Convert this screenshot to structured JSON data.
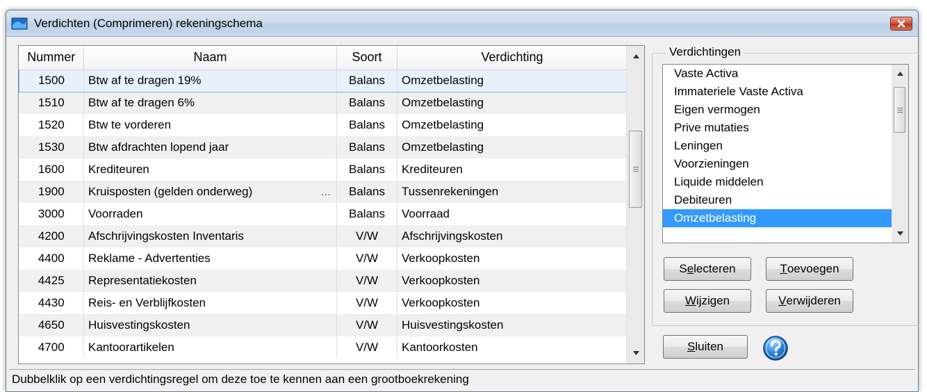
{
  "window": {
    "title": "Verdichten (Comprimeren) rekeningschema"
  },
  "table": {
    "headers": {
      "nummer": "Nummer",
      "naam": "Naam",
      "soort": "Soort",
      "verdichting": "Verdichting"
    },
    "rows": [
      {
        "nummer": "1500",
        "naam": "Btw af te dragen 19%",
        "soort": "Balans",
        "verdichting": "Omzetbelasting",
        "ellipsis": ""
      },
      {
        "nummer": "1510",
        "naam": "Btw af te dragen 6%",
        "soort": "Balans",
        "verdichting": "Omzetbelasting",
        "ellipsis": ""
      },
      {
        "nummer": "1520",
        "naam": "Btw te vorderen",
        "soort": "Balans",
        "verdichting": "Omzetbelasting",
        "ellipsis": ""
      },
      {
        "nummer": "1530",
        "naam": "Btw afdrachten lopend jaar",
        "soort": "Balans",
        "verdichting": "Omzetbelasting",
        "ellipsis": ""
      },
      {
        "nummer": "1600",
        "naam": "Krediteuren",
        "soort": "Balans",
        "verdichting": "Krediteuren",
        "ellipsis": ""
      },
      {
        "nummer": "1900",
        "naam": "Kruisposten (gelden onderweg)",
        "soort": "Balans",
        "verdichting": "Tussenrekeningen",
        "ellipsis": "..."
      },
      {
        "nummer": "3000",
        "naam": "Voorraden",
        "soort": "Balans",
        "verdichting": "Voorraad",
        "ellipsis": ""
      },
      {
        "nummer": "4200",
        "naam": "Afschrijvingskosten Inventaris",
        "soort": "V/W",
        "verdichting": "Afschrijvingskosten",
        "ellipsis": ""
      },
      {
        "nummer": "4400",
        "naam": "Reklame - Advertenties",
        "soort": "V/W",
        "verdichting": "Verkoopkosten",
        "ellipsis": ""
      },
      {
        "nummer": "4425",
        "naam": "Representatiekosten",
        "soort": "V/W",
        "verdichting": "Verkoopkosten",
        "ellipsis": ""
      },
      {
        "nummer": "4430",
        "naam": "Reis- en Verblijfkosten",
        "soort": "V/W",
        "verdichting": "Verkoopkosten",
        "ellipsis": ""
      },
      {
        "nummer": "4650",
        "naam": "Huisvestingskosten",
        "soort": "V/W",
        "verdichting": "Huisvestingskosten",
        "ellipsis": ""
      },
      {
        "nummer": "4700",
        "naam": "Kantoorartikelen",
        "soort": "V/W",
        "verdichting": "Kantoorkosten",
        "ellipsis": ""
      }
    ]
  },
  "verdichtingen": {
    "legend": "Verdichtingen",
    "items": [
      "Vaste Activa",
      "Immateriele Vaste Activa",
      "Eigen vermogen",
      "Prive mutaties",
      "Leningen",
      "Voorzieningen",
      "Liquide middelen",
      "Debiteuren",
      "Omzetbelasting"
    ],
    "selected": "Omzetbelasting"
  },
  "buttons": {
    "selecteren": {
      "pre": "S",
      "u": "e",
      "post": "lecteren"
    },
    "toevoegen": {
      "pre": "",
      "u": "T",
      "post": "oevoegen"
    },
    "wijzigen": {
      "pre": "",
      "u": "W",
      "post": "ijzigen"
    },
    "verwijderen": {
      "pre": "",
      "u": "V",
      "post": "erwijderen"
    },
    "sluiten": {
      "pre": "",
      "u": "S",
      "post": "luiten"
    }
  },
  "status": "Dubbelklik op een verdichtingsregel om deze toe te kennen aan een grootboekrekening",
  "colors": {
    "selection": "#3399ff",
    "row_selected": "#e8f1fb",
    "help": "#2a7fd8"
  }
}
